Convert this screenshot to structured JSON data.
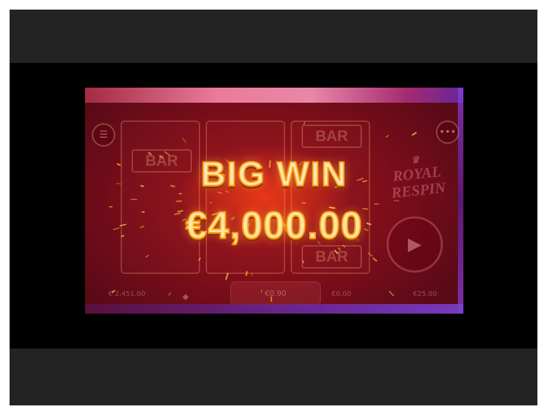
{
  "popup": {
    "title": "BIG WIN",
    "amount": "€4,000.00"
  },
  "reels": {
    "symbol_label": "BAR"
  },
  "logo": {
    "line1": "ROYAL",
    "line2": "RESPIN"
  },
  "hud": {
    "balance_value": "€ 2,451.00",
    "stake_value": "€0.90",
    "win_value": "€0.00",
    "bet_value": "€25.00"
  },
  "icons": {
    "menu": "menu-icon",
    "more": "more-icon",
    "spin": "spin-icon"
  },
  "colors": {
    "background": "#000000",
    "letterbox": "#232323",
    "game_red": "#8e1019",
    "win_text": "#ffe8b0",
    "win_stroke": "#ff9a10"
  }
}
